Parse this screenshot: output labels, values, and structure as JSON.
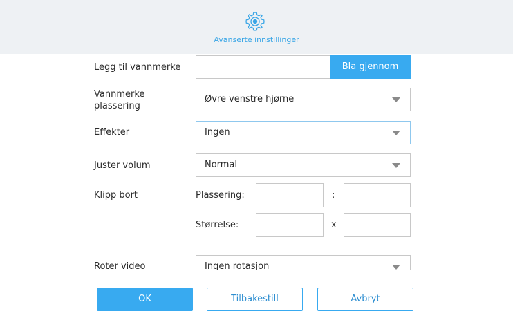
{
  "header": {
    "title": "Avanserte innstillinger",
    "icon": "gear-icon",
    "accent": "#3aa6e6"
  },
  "watermark": {
    "label": "Legg til vannmerke",
    "value": "",
    "browse_label": "Bla gjennom"
  },
  "placement": {
    "label_line1": "Vannmerke",
    "label_line2": "plassering",
    "selected": "Øvre venstre hjørne"
  },
  "effects": {
    "label": "Effekter",
    "selected": "Ingen"
  },
  "volume": {
    "label": "Juster volum",
    "selected": "Normal"
  },
  "crop": {
    "label": "Klipp bort",
    "position_label": "Plassering:",
    "position_separator": ":",
    "size_label": "Størrelse:",
    "size_separator": "x",
    "position_x": "",
    "position_y": "",
    "size_w": "",
    "size_h": ""
  },
  "rotate": {
    "label": "Roter video",
    "selected": "Ingen rotasjon"
  },
  "footer": {
    "ok_label": "OK",
    "reset_label": "Tilbakestill",
    "cancel_label": "Avbryt"
  },
  "colors": {
    "primary_button": "#38aaf0",
    "header_bg": "#eef1f4"
  }
}
